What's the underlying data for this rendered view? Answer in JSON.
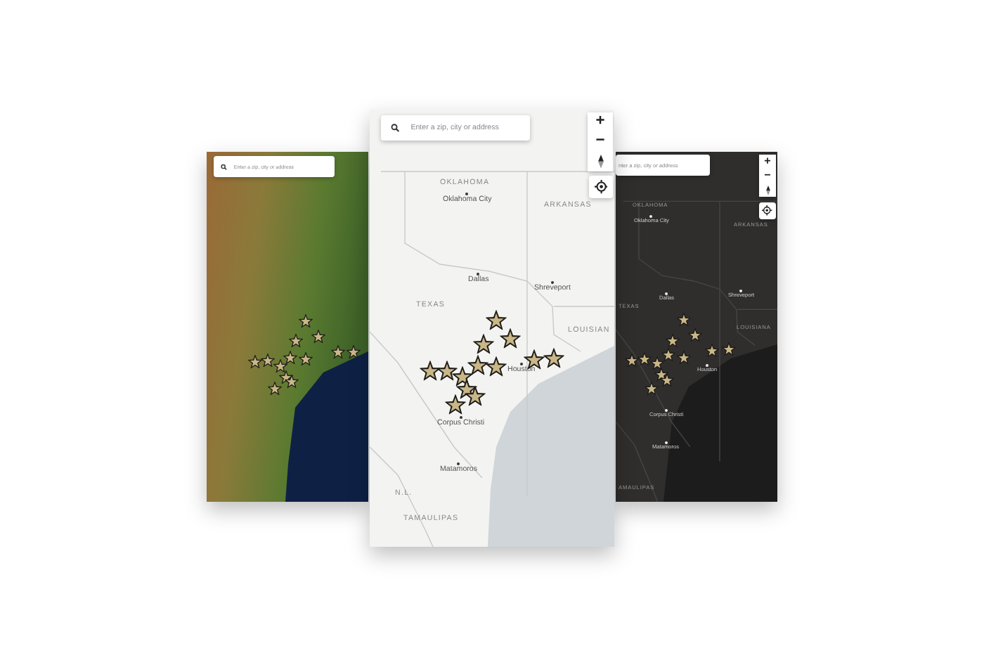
{
  "panels": [
    {
      "kind": "satellite",
      "search": {
        "placeholder": "Enter a zip, city or address"
      }
    },
    {
      "kind": "light",
      "search": {
        "placeholder": "Enter a zip, city or address"
      },
      "controls": {
        "zoom_in": "+",
        "zoom_out": "−"
      },
      "labels": [
        {
          "text": "OKLAHOMA",
          "kind": "region"
        },
        {
          "text": "Oklahoma City",
          "kind": "city"
        },
        {
          "text": "ARKANSAS",
          "kind": "region"
        },
        {
          "text": "Dallas",
          "kind": "city"
        },
        {
          "text": "Shreveport",
          "kind": "city"
        },
        {
          "text": "TEXAS",
          "kind": "region"
        },
        {
          "text": "LOUISIAN",
          "kind": "region"
        },
        {
          "text": "Houston",
          "kind": "city"
        },
        {
          "text": "Corpus Christi",
          "kind": "city"
        },
        {
          "text": "Matamoros",
          "kind": "city"
        },
        {
          "text": "N.L.",
          "kind": "region"
        },
        {
          "text": "TAMAULIPAS",
          "kind": "region"
        }
      ]
    },
    {
      "kind": "dark",
      "search": {
        "placeholder": "nter a zip, city or address"
      },
      "controls": {
        "zoom_in": "+",
        "zoom_out": "−"
      },
      "labels": [
        {
          "text": "OKLAHOMA",
          "kind": "region"
        },
        {
          "text": "Oklahoma City",
          "kind": "city"
        },
        {
          "text": "ARKANSAS",
          "kind": "region"
        },
        {
          "text": "TEXAS",
          "kind": "region"
        },
        {
          "text": "Dallas",
          "kind": "city"
        },
        {
          "text": "Shreveport",
          "kind": "city"
        },
        {
          "text": "LOUISIANA",
          "kind": "region"
        },
        {
          "text": "Houston",
          "kind": "city"
        },
        {
          "text": "Corpus Christi",
          "kind": "city"
        },
        {
          "text": "Matamoros",
          "kind": "city"
        },
        {
          "text": "AMAULIPAS",
          "kind": "region"
        }
      ]
    }
  ]
}
